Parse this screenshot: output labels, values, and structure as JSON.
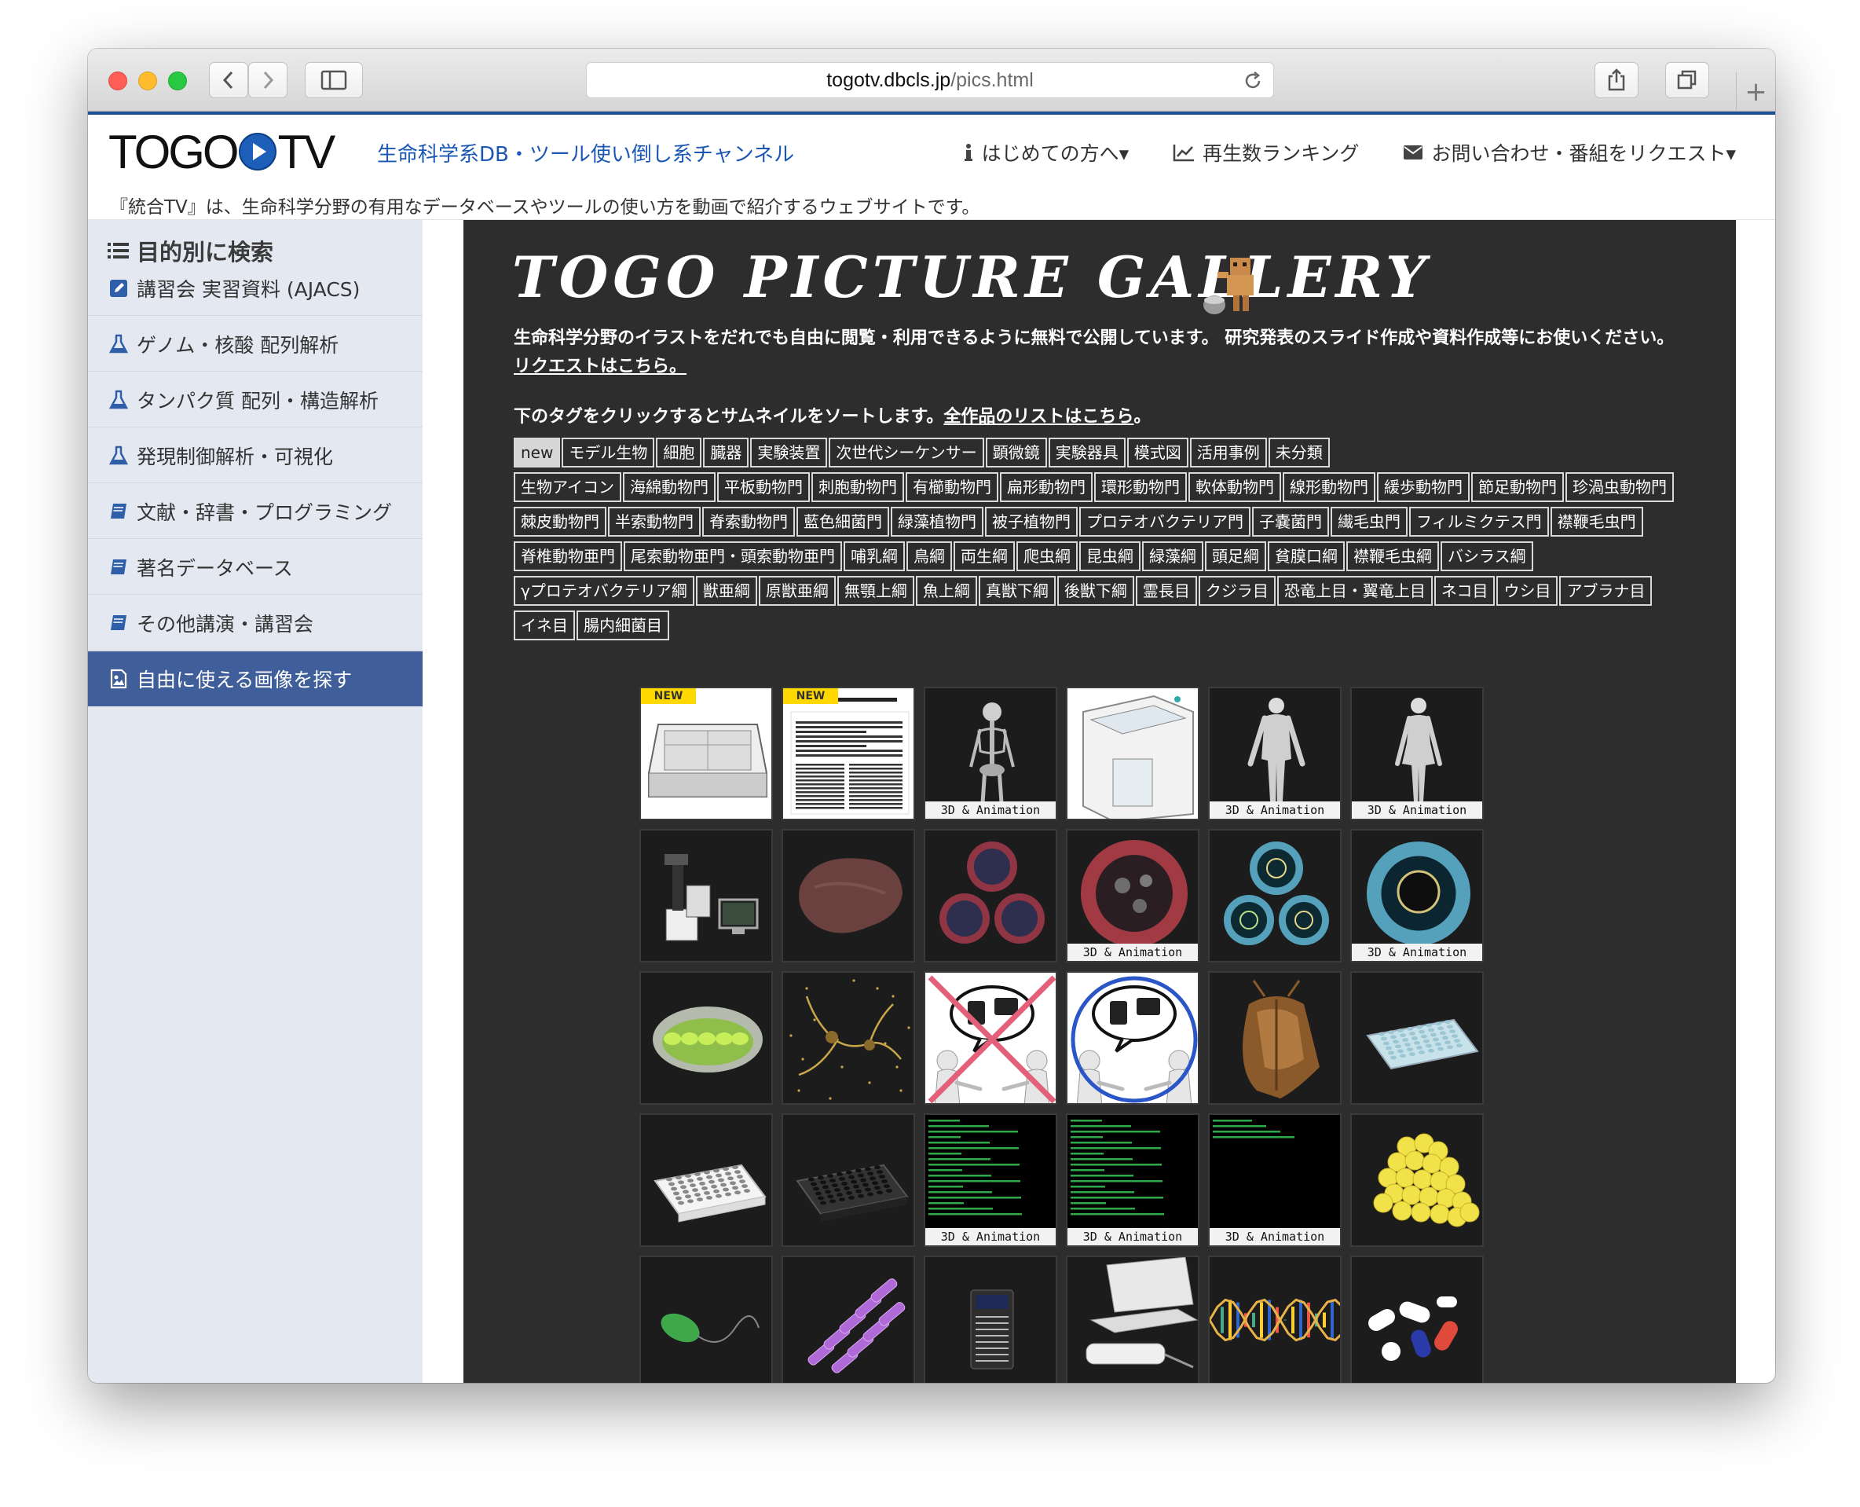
{
  "browser": {
    "url_domain": "togotv.dbcls.jp",
    "url_path": "/pics.html"
  },
  "site": {
    "logo_left": "TOGO",
    "logo_right": "TV",
    "tagline": "生命科学系DB・ツール使い倒し系チャンネル",
    "subtitle": "『統合TV』は、生命科学分野の有用なデータベースやツールの使い方を動画で紹介するウェブサイトです。",
    "nav": [
      {
        "label": "はじめての方へ▾",
        "icon": "info-icon"
      },
      {
        "label": "再生数ランキング",
        "icon": "chart-icon"
      },
      {
        "label": "お問い合わせ・番組をリクエスト▾",
        "icon": "envelope-icon"
      }
    ]
  },
  "sidebar": {
    "heading": "目的別に検索",
    "items": [
      {
        "label": "講習会 実習資料 (AJACS)",
        "icon": "edit-icon"
      },
      {
        "label": "ゲノム・核酸 配列解析",
        "icon": "flask-icon"
      },
      {
        "label": "タンパク質 配列・構造解析",
        "icon": "flask-icon"
      },
      {
        "label": "発現制御解析・可視化",
        "icon": "flask-icon"
      },
      {
        "label": "文献・辞書・プログラミング",
        "icon": "book-icon"
      },
      {
        "label": "著名データベース",
        "icon": "book-icon"
      },
      {
        "label": "その他講演・講習会",
        "icon": "book-icon"
      },
      {
        "label": "自由に使える画像を探す",
        "icon": "image-icon",
        "active": true
      }
    ]
  },
  "gallery": {
    "title": "TOGO PICTURE GALLERY",
    "intro": "生命科学分野のイラストをだれでも自由に閲覧・利用できるように無料で公開しています。 研究発表のスライド作成や資料作成等にお使いください。",
    "request_link": "リクエストはこちら。",
    "sort_text": "下のタグをクリックするとサムネイルをソートします。",
    "list_link": "全作品のリストはこちら",
    "sort_end": "。",
    "tag_rows": [
      [
        "new",
        "モデル生物",
        "細胞",
        "臓器",
        "実験装置",
        "次世代シーケンサー",
        "顕微鏡",
        "実験器具",
        "模式図",
        "活用事例",
        "未分類"
      ],
      [
        "生物アイコン",
        "海綿動物門",
        "平板動物門",
        "刺胞動物門",
        "有櫛動物門",
        "扁形動物門",
        "環形動物門",
        "軟体動物門",
        "線形動物門",
        "緩歩動物門",
        "節足動物門",
        "珍渦虫動物門"
      ],
      [
        "棘皮動物門",
        "半索動物門",
        "脊索動物門",
        "藍色細菌門",
        "緑藻植物門",
        "被子植物門",
        "プロテオバクテリア門",
        "子嚢菌門",
        "繊毛虫門",
        "フィルミクテス門",
        "襟鞭毛虫門"
      ],
      [
        "脊椎動物亜門",
        "尾索動物亜門・頭索動物亜門",
        "哺乳綱",
        "鳥綱",
        "両生綱",
        "爬虫綱",
        "昆虫綱",
        "緑藻綱",
        "頭足綱",
        "貧膜口綱",
        "襟鞭毛虫綱",
        "バシラス綱"
      ],
      [
        "γプロテオバクテリア綱",
        "獣亜綱",
        "原獣亜綱",
        "無顎上綱",
        "魚上綱",
        "真獣下綱",
        "後獣下綱",
        "霊長目",
        "クジラ目",
        "恐竜上目・翼竜上目",
        "ネコ目",
        "ウシ目",
        "アブラナ目"
      ],
      [
        "イネ目",
        "腸内細菌目"
      ]
    ],
    "selected_tag": "new",
    "badge_new": "NEW",
    "label_3d": "3D & Animation",
    "thumbs": [
      {
        "kind": "sequencer-sheet",
        "new": true,
        "anim": false
      },
      {
        "kind": "paper-document",
        "new": true,
        "anim": false
      },
      {
        "kind": "skeleton",
        "new": false,
        "anim": true
      },
      {
        "kind": "lab-machine",
        "new": false,
        "anim": false
      },
      {
        "kind": "human-male",
        "new": false,
        "anim": true
      },
      {
        "kind": "human-female",
        "new": false,
        "anim": true
      },
      {
        "kind": "microscope",
        "new": false,
        "anim": false
      },
      {
        "kind": "liver",
        "new": false,
        "anim": false
      },
      {
        "kind": "cells-red-trio",
        "new": false,
        "anim": false
      },
      {
        "kind": "cell-red",
        "new": false,
        "anim": true
      },
      {
        "kind": "cells-blue-trio",
        "new": false,
        "anim": false
      },
      {
        "kind": "cell-blue",
        "new": false,
        "anim": true
      },
      {
        "kind": "chloroplast",
        "new": false,
        "anim": false
      },
      {
        "kind": "neurons",
        "new": false,
        "anim": false
      },
      {
        "kind": "sns-bad",
        "new": false,
        "anim": false
      },
      {
        "kind": "sns-good",
        "new": false,
        "anim": false
      },
      {
        "kind": "moth",
        "new": false,
        "anim": false
      },
      {
        "kind": "plate-blue",
        "new": false,
        "anim": false
      },
      {
        "kind": "plate-white",
        "new": false,
        "anim": false
      },
      {
        "kind": "plate-black",
        "new": false,
        "anim": false
      },
      {
        "kind": "terminal",
        "new": false,
        "anim": true
      },
      {
        "kind": "terminal",
        "new": false,
        "anim": true
      },
      {
        "kind": "terminal-empty",
        "new": false,
        "anim": true
      },
      {
        "kind": "beads",
        "new": false,
        "anim": false
      },
      {
        "kind": "bacterium",
        "new": false,
        "anim": false
      },
      {
        "kind": "crystals",
        "new": false,
        "anim": false
      },
      {
        "kind": "device",
        "new": false,
        "anim": false
      },
      {
        "kind": "laptop-sequencer",
        "new": false,
        "anim": false
      },
      {
        "kind": "dna",
        "new": false,
        "anim": false
      },
      {
        "kind": "pills",
        "new": false,
        "anim": false
      }
    ]
  }
}
